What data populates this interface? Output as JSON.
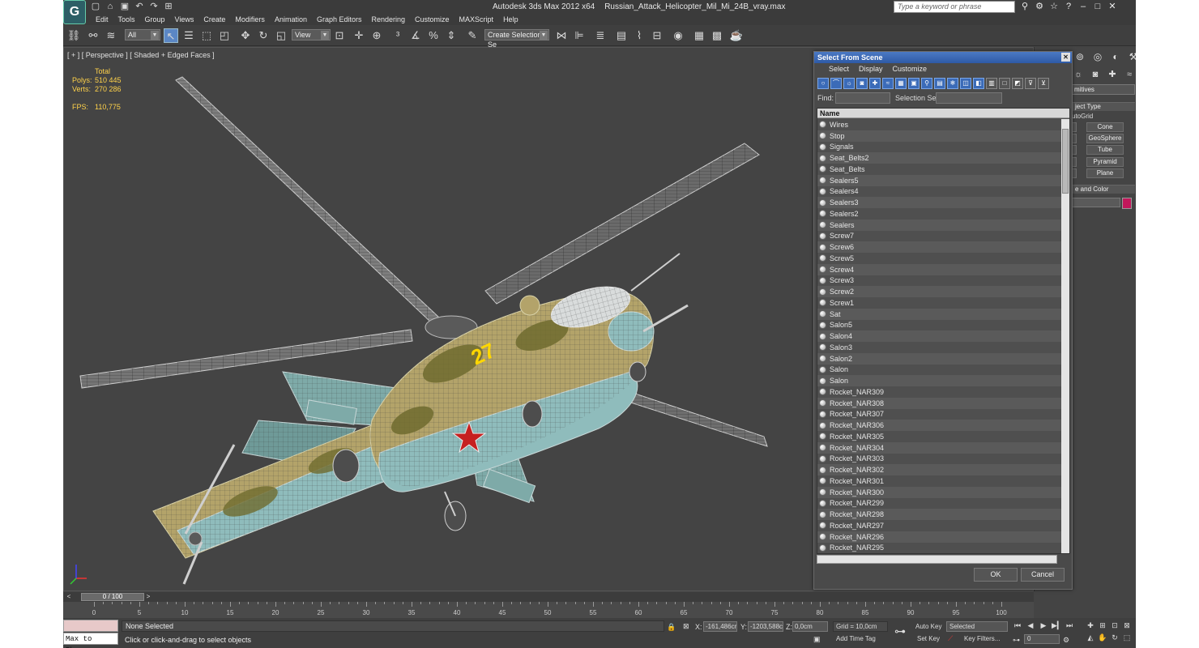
{
  "titlebar": {
    "app": "Autodesk 3ds Max  2012 x64",
    "file": "Russian_Attack_Helicopter_Mil_Mi_24B_vray.max",
    "search_placeholder": "Type a keyword or phrase"
  },
  "menu": [
    "Edit",
    "Tools",
    "Group",
    "Views",
    "Create",
    "Modifiers",
    "Animation",
    "Graph Editors",
    "Rendering",
    "Customize",
    "MAXScript",
    "Help"
  ],
  "toolbar": {
    "filter": "All",
    "ref_coord": "View",
    "selection_set": "Create Selection Se"
  },
  "viewport": {
    "label": "[ + ] [ Perspective ] [ Shaded + Edged Faces ]",
    "stats_header": "Total",
    "polys_label": "Polys:",
    "polys": "510 445",
    "verts_label": "Verts:",
    "verts": "270 286",
    "fps_label": "FPS:",
    "fps": "110,775",
    "tail_text": "27"
  },
  "command_panel": {
    "dropdown": "mitives",
    "object_type": "ject Type",
    "autogrid": "utoGrid",
    "buttons": [
      "Cone",
      "GeoSphere",
      "Tube",
      "Pyramid",
      "Plane"
    ],
    "name_color": "e and Color"
  },
  "dialog": {
    "title": "Select From Scene",
    "menus": [
      "Select",
      "Display",
      "Customize"
    ],
    "find_label": "Find:",
    "selection_set_label": "Selection Set:",
    "column_name": "Name",
    "items": [
      "Wires",
      "Stop",
      "Signals",
      "Seat_Belts2",
      "Seat_Belts",
      "Sealers5",
      "Sealers4",
      "Sealers3",
      "Sealers2",
      "Sealers",
      "Screw7",
      "Screw6",
      "Screw5",
      "Screw4",
      "Screw3",
      "Screw2",
      "Screw1",
      "Sat",
      "Salon5",
      "Salon4",
      "Salon3",
      "Salon2",
      "Salon",
      "Salon",
      "Rocket_NAR309",
      "Rocket_NAR308",
      "Rocket_NAR307",
      "Rocket_NAR306",
      "Rocket_NAR305",
      "Rocket_NAR304",
      "Rocket_NAR303",
      "Rocket_NAR302",
      "Rocket_NAR301",
      "Rocket_NAR300",
      "Rocket_NAR299",
      "Rocket_NAR298",
      "Rocket_NAR297",
      "Rocket_NAR296",
      "Rocket_NAR295"
    ],
    "ok": "OK",
    "cancel": "Cancel"
  },
  "timeline": {
    "frame": "0 / 100",
    "ticks": [
      "0",
      "5",
      "10",
      "15",
      "20",
      "25",
      "30",
      "35",
      "40",
      "45",
      "50",
      "55",
      "60",
      "65",
      "70",
      "75",
      "80",
      "85",
      "90",
      "95",
      "100"
    ]
  },
  "status": {
    "maxphys": "Max to Physc",
    "selection": "None Selected",
    "prompt": "Click or click-and-drag to select objects",
    "x_label": "X:",
    "x": "-161,486cr",
    "y_label": "Y:",
    "y": "-1203,588c",
    "z_label": "Z:",
    "z": "0,0cm",
    "grid": "Grid = 10,0cm",
    "add_time_tag": "Add Time Tag",
    "auto_key": "Auto Key",
    "set_key": "Set Key",
    "selected": "Selected",
    "key_filters": "Key Filters...",
    "frame_value": "0"
  },
  "colors": {
    "accent": "#4b79c4",
    "camo_tan": "#b3a36a",
    "camo_green": "#6f6b2e",
    "belly_teal": "#8fbcbc",
    "star_red": "#c62020",
    "stats_yellow": "#ffd24a"
  }
}
